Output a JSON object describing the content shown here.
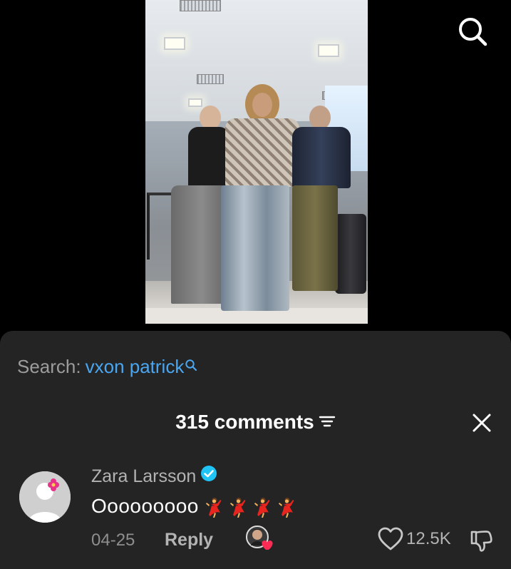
{
  "search": {
    "prefix": "Search:",
    "term": "vxon patrick"
  },
  "comments": {
    "count_label": "315 comments"
  },
  "comment": {
    "username": "Zara Larsson",
    "text": "Ooooooooo",
    "emoji_count": 4,
    "emoji": "dancer",
    "date": "04-25",
    "reply_label": "Reply",
    "like_count": "12.5K"
  },
  "colors": {
    "sheet_bg": "#242424",
    "link_blue": "#4aa6f0",
    "verified_blue": "#20c4f4"
  },
  "icons": {
    "top_search": "search-icon",
    "filter": "filter-icon",
    "close": "close-icon",
    "verified": "verified-badge-icon",
    "like": "heart-outline-icon",
    "dislike": "thumbs-down-icon"
  }
}
